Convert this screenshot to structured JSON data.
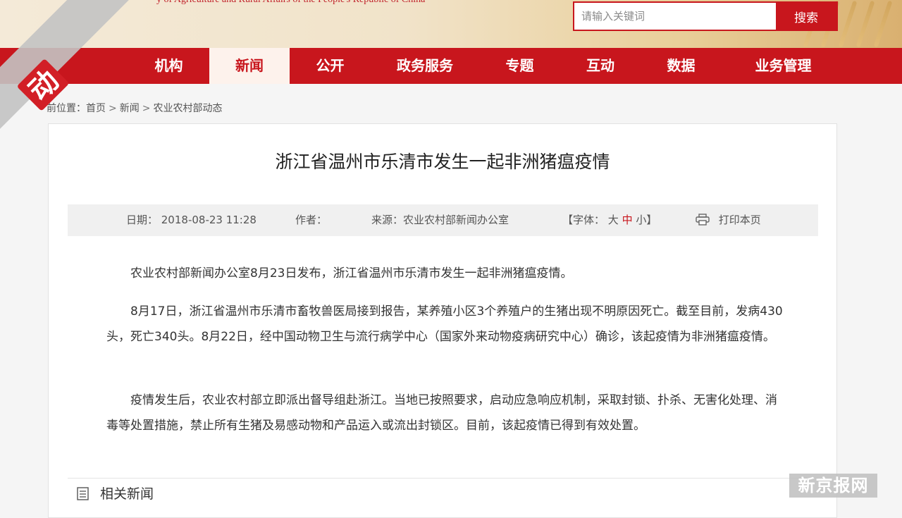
{
  "header": {
    "subtitle_partial": "y of Agriculture and Rural Affairs of the People's Republic of China",
    "search": {
      "placeholder": "请输入关键词",
      "button_label": "搜索"
    }
  },
  "nav": {
    "items": [
      {
        "label": "机构"
      },
      {
        "label": "新闻",
        "active": true
      },
      {
        "label": "公开"
      },
      {
        "label": "政务服务"
      },
      {
        "label": "专题"
      },
      {
        "label": "互动"
      },
      {
        "label": "数据"
      },
      {
        "label": "业务管理"
      }
    ]
  },
  "breadcrumb": {
    "prefix": "前位置：",
    "items": [
      "首页",
      "新闻",
      "农业农村部动态"
    ],
    "separator": ">"
  },
  "article": {
    "title": "浙江省温州市乐清市发生一起非洲猪瘟疫情",
    "meta": {
      "date": "日期： 2018-08-23 11:28",
      "author": "作者：",
      "source": "来源：农业农村部新闻办公室",
      "font_open": "【字体：",
      "font_large": "大",
      "font_medium": "中",
      "font_small": "小",
      "font_close": "】",
      "print": "打印本页"
    },
    "paragraphs": [
      "农业农村部新闻办公室8月23日发布，浙江省温州市乐清市发生一起非洲猪瘟疫情。",
      "8月17日，浙江省温州市乐清市畜牧兽医局接到报告，某养殖小区3个养殖户的生猪出现不明原因死亡。截至目前，发病430头，死亡340头。8月22日，经中国动物卫生与流行病学中心（国家外来动物疫病研究中心）确诊，该起疫情为非洲猪瘟疫情。",
      "疫情发生后，农业农村部立即派出督导组赴浙江。当地已按照要求，启动应急响应机制，采取封锁、扑杀、无害化处理、消毒等处置措施，禁止所有生猪及易感动物和产品运入或流出封锁区。目前，该起疫情已得到有效处置。"
    ],
    "related_title": "相关新闻"
  },
  "watermarks": {
    "corner_text": "动新闻",
    "brand_text": "新京报网"
  },
  "colors": {
    "accent": "#c8161d",
    "nav_active_bg": "#fdf2ec",
    "meta_bg": "#f0f0f0"
  },
  "icons": {
    "print": "printer-icon",
    "related": "document-list-icon",
    "search_button": "search-button"
  }
}
